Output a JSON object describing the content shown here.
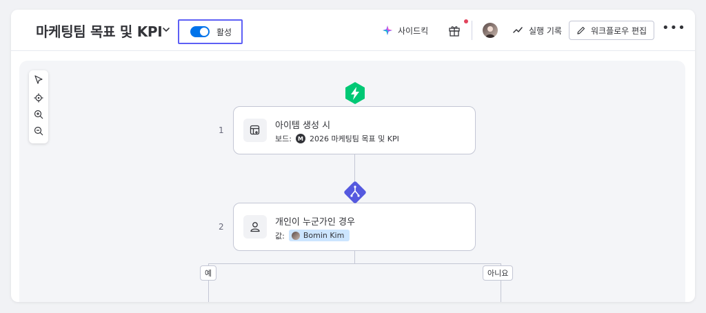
{
  "header": {
    "title": "마케팅팀 목표 및 KPI",
    "toggle_label": "활성",
    "toggle_on": true,
    "sidekick_label": "사이드킥",
    "history_label": "실행 기록",
    "edit_label": "워크플로우 편집",
    "more_label": "•••",
    "notification_color": "#e2445c",
    "accent": "#0073ea",
    "highlight_border": "#5d5ff5"
  },
  "toolbox": {
    "tools": [
      "pointer-icon",
      "recenter-icon",
      "zoom-in-icon",
      "zoom-out-icon"
    ]
  },
  "steps": [
    {
      "number": "1",
      "title": "아이템 생성 시",
      "sub_label": "보드:",
      "board_letter": "M",
      "board_name": "2026 마케팅팀 목표 및 KPI",
      "icon": "item-create-icon",
      "badge": "lightning-icon",
      "badge_color": "#00c875"
    },
    {
      "number": "2",
      "title": "개인이 누군가인 경우",
      "sub_label": "값:",
      "person_name": "Bomin Kim",
      "icon": "person-icon",
      "badge": "branch-icon",
      "badge_color": "#5559df"
    }
  ],
  "branches": {
    "yes_label": "예",
    "no_label": "아니요"
  }
}
